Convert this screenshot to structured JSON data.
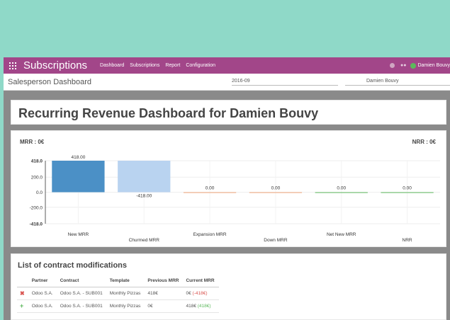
{
  "app": {
    "title": "Subscriptions",
    "menu": [
      "Dashboard",
      "Subscriptions",
      "Report",
      "Configuration"
    ],
    "user": "Damien Bouvy"
  },
  "control": {
    "title": "Salesperson Dashboard",
    "date": "2016-09",
    "salesperson": "Damien Bouvy"
  },
  "dashboard": {
    "title": "Recurring Revenue Dashboard for Damien Bouvy",
    "mrr_label": "MRR : 0€",
    "nrr_label": "NRR : 0€"
  },
  "chart_data": {
    "type": "bar",
    "categories": [
      "New MRR",
      "Churmed MRR",
      "Expansion MRR",
      "Down MRR",
      "Net New MRR",
      "NRR"
    ],
    "values": [
      418,
      -418,
      0,
      0,
      0,
      0
    ],
    "value_labels": [
      "418.00",
      "-418.00",
      "0.00",
      "0.00",
      "0.00",
      "0.00"
    ],
    "bar_bases": [
      0,
      418,
      0,
      0,
      0,
      0
    ],
    "yticks": [
      "418.0",
      "200.0",
      "0.0",
      "-200.0",
      "-418.0"
    ],
    "ytick_values": [
      418,
      200,
      0,
      -200,
      -418
    ],
    "ylim": [
      -418,
      418
    ],
    "colors": [
      "#4b90c6",
      "#b9d3f0",
      "#f0a47a",
      "#f0a47a",
      "#5cb85c",
      "#5cb85c"
    ],
    "grid": true
  },
  "list": {
    "title": "List of contract modifications",
    "headers": [
      "Partner",
      "Contract",
      "Template",
      "Previous MRR",
      "Current MRR"
    ],
    "rows": [
      {
        "icon": "✖",
        "partner": "Odoo S.A.",
        "contract": "Odoo S.A. - SUB001",
        "template": "Monthly Pizzas",
        "previous": "418€",
        "current": "0€",
        "delta": "(-418€)"
      },
      {
        "icon": "+",
        "partner": "Odoo S.A.",
        "contract": "Odoo S.A. - SUB001",
        "template": "Monthly Pizzas",
        "previous": "0€",
        "current": "418€",
        "delta": "(418€)"
      }
    ]
  }
}
